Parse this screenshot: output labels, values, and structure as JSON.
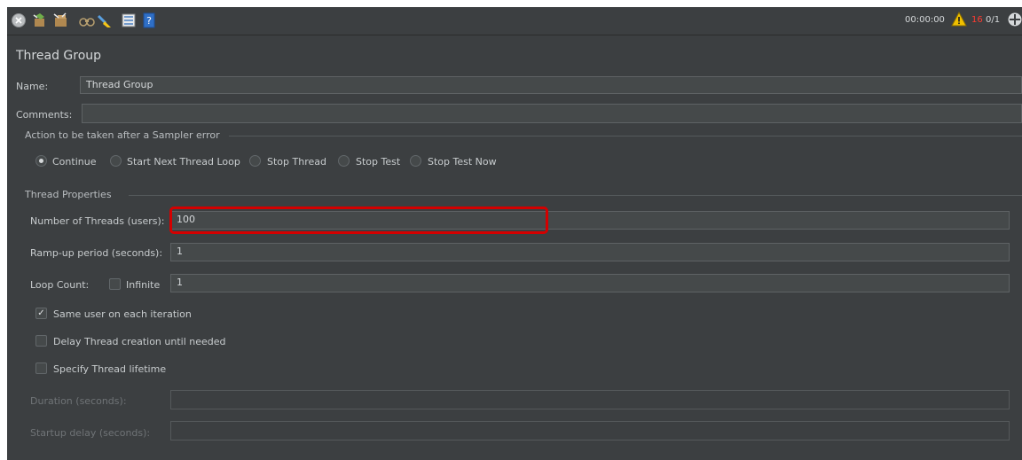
{
  "toolbar": {
    "icons": [
      "stop-icon",
      "clear-icon",
      "clear-all-icon",
      "search-icon",
      "reset-search-icon",
      "function-helper-icon",
      "help-icon"
    ],
    "timer": "00:00:00",
    "error_count": "16",
    "thread_count": "0/1",
    "colors": {
      "warning": "#f0c000",
      "error": "#ff3b30"
    }
  },
  "panel": {
    "title": "Thread Group",
    "name_label": "Name:",
    "name_value": "Thread Group",
    "comments_label": "Comments:",
    "comments_value": ""
  },
  "sampler_error": {
    "section_label": "Action to be taken after a Sampler error",
    "options": [
      {
        "label": "Continue",
        "selected": true
      },
      {
        "label": "Start Next Thread Loop",
        "selected": false
      },
      {
        "label": "Stop Thread",
        "selected": false
      },
      {
        "label": "Stop Test",
        "selected": false
      },
      {
        "label": "Stop Test Now",
        "selected": false
      }
    ]
  },
  "thread_properties": {
    "section_label": "Thread Properties",
    "num_threads_label": "Number of Threads (users):",
    "num_threads_value": "100",
    "ramp_up_label": "Ramp-up period (seconds):",
    "ramp_up_value": "1",
    "loop_count_label": "Loop Count:",
    "infinite_label": "Infinite",
    "infinite_checked": false,
    "loop_count_value": "1",
    "same_user_label": "Same user on each iteration",
    "same_user_checked": true,
    "delay_creation_label": "Delay Thread creation until needed",
    "delay_creation_checked": false,
    "specify_lifetime_label": "Specify Thread lifetime",
    "specify_lifetime_checked": false,
    "duration_label": "Duration (seconds):",
    "duration_value": "",
    "startup_delay_label": "Startup delay (seconds):",
    "startup_delay_value": ""
  },
  "highlight_color": "#d40000"
}
